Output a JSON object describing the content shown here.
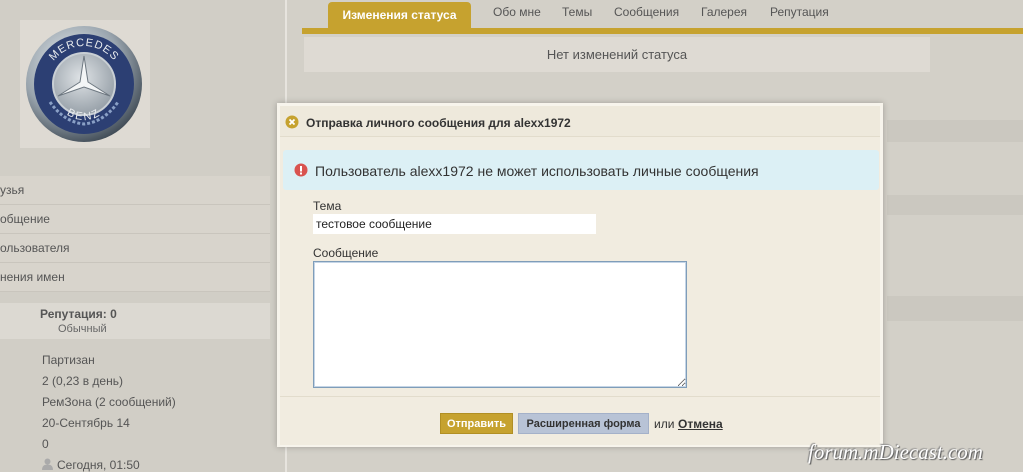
{
  "sidebar": {
    "avatar_alt": "Mercedes-Benz",
    "logo_top": "MERCEDES",
    "logo_bottom": "BENZ",
    "nav_items": [
      {
        "label": "узья"
      },
      {
        "label": "общение"
      },
      {
        "label": "ользователя"
      },
      {
        "label": "нения имен"
      }
    ],
    "reputation_title": "Репутация: 0",
    "reputation_level": "Обычный",
    "info": [
      "Партизан",
      "2 (0,23 в день)",
      "РемЗона (2 сообщений)",
      "20-Сентябрь 14",
      "0",
      "Сегодня, 01:50"
    ]
  },
  "tabs": {
    "active": "Изменения статуса",
    "items": [
      "Обо мне",
      "Темы",
      "Сообщения",
      "Галерея",
      "Репутация"
    ]
  },
  "status_text": "Нет изменений статуса",
  "modal": {
    "title": "Отправка личного сообщения для alexx1972",
    "error": "Пользователь alexx1972 не может использовать личные сообщения",
    "subject_label": "Тема",
    "subject_value": "тестовое сообщение",
    "message_label": "Сообщение",
    "send_label": "Отправить",
    "advanced_label": "Расширенная форма",
    "or_label": "или",
    "cancel_label": "Отмена"
  },
  "watermark": "forum.mDiecast.com",
  "colors": {
    "accent": "#c6a22f",
    "page_bg": "#d3d0c8",
    "modal_bg": "#f1ece0",
    "error_bg": "#dcf0f5",
    "advanced_button": "#b8c3d6"
  }
}
